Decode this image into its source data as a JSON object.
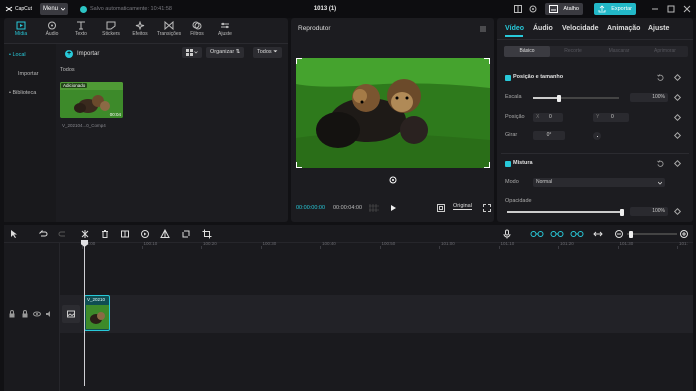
{
  "titlebar": {
    "app_logo": "CapCut",
    "menu_label": "Menu",
    "save_status": "Salvo automaticamente: 10:41:58",
    "project_title": "1013 (1)",
    "shortcut_label": "Atalho",
    "export_label": "Exportar"
  },
  "media": {
    "tabs": [
      {
        "label": "Mídia",
        "icon": "media-icon"
      },
      {
        "label": "Áudio",
        "icon": "audio-icon"
      },
      {
        "label": "Texto",
        "icon": "text-icon"
      },
      {
        "label": "Stickers",
        "icon": "sticker-icon"
      },
      {
        "label": "Efeitos",
        "icon": "effects-icon"
      },
      {
        "label": "Transições",
        "icon": "transition-icon"
      },
      {
        "label": "Filtros",
        "icon": "filter-icon"
      },
      {
        "label": "Ajuste",
        "icon": "adjust-icon"
      }
    ],
    "sidenav": {
      "local": "• Local",
      "import": "Importar",
      "library": "• Biblioteca"
    },
    "import_label": "Importar",
    "organize_label": "Organizar",
    "all_label": "Todos",
    "section_all": "Todos",
    "thumb_badge": "Adicionado",
    "thumb_duration": "00:04",
    "thumb_name": "V_202104...0_Comp4"
  },
  "player": {
    "title": "Reprodutor",
    "time_current": "00:00:00:00",
    "time_total": "00:00:04:00",
    "original_label": "Original"
  },
  "props": {
    "tabs": [
      "Vídeo",
      "Áudio",
      "Velocidade",
      "Animação",
      "Ajuste"
    ],
    "subtabs": [
      "Básico",
      "Recorte",
      "Mascarar",
      "Aprimorar"
    ],
    "pos_section": "Posição e tamanho",
    "scale_label": "Escala",
    "scale_value": "100%",
    "scale_level": 0.3,
    "position_label": "Posição",
    "pos_x_label": "X",
    "pos_x": "0",
    "pos_y_label": "Y",
    "pos_y": "0",
    "rotate_label": "Girar",
    "rotate_value": "0°",
    "blend_section": "Mistura",
    "mode_label": "Modo",
    "mode_value": "Normal",
    "opacity_label": "Opacidade",
    "opacity_value": "100%",
    "opacity_level": 1.0
  },
  "timeline": {
    "ticks": [
      "00:00",
      "100:10",
      "100:20",
      "100:30",
      "100:40",
      "100:50",
      "101:00",
      "101:10",
      "101:20",
      "101:30",
      "101:"
    ],
    "clip_name": "V_20210"
  },
  "colors": {
    "accent": "#28c9d9",
    "export_btn": "#22b8c8",
    "panel": "#1c1c20",
    "background": "#111114"
  }
}
